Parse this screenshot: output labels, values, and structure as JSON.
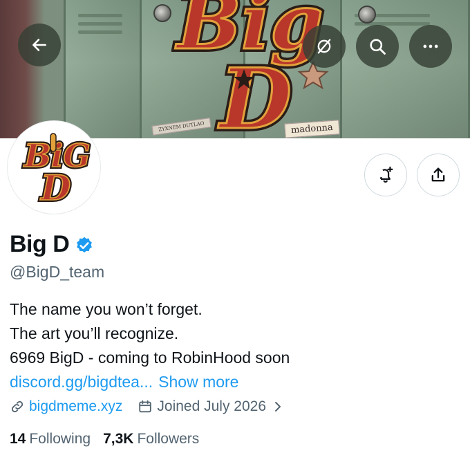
{
  "banner": {
    "sticker_text": "madonna",
    "sticker_small_text": "ZYXNEM DUTLAO"
  },
  "header_buttons": [
    {
      "icon": "back-arrow-icon"
    },
    {
      "icon": "translate-icon"
    },
    {
      "icon": "search-icon"
    },
    {
      "icon": "more-icon"
    }
  ],
  "actions": [
    {
      "icon": "notification-add-icon"
    },
    {
      "icon": "share-icon"
    }
  ],
  "profile": {
    "display_name": "Big D",
    "handle": "@BigD_team",
    "verified": true,
    "verified_color": "#1d9bf0",
    "bio_lines": [
      "The name you won’t forget.",
      "The art you’ll recognize.",
      "6969 BigD - coming to RobinHood soon"
    ],
    "bio_link": "discord.gg/bigdtea...",
    "show_more": "Show more",
    "website": "bigdmeme.xyz",
    "joined": "Joined July 2026",
    "following_count": "14",
    "following_label": "Following",
    "followers_count": "7,3K",
    "followers_label": "Followers"
  },
  "colors": {
    "accent": "#1d9bf0",
    "text_primary": "#0f1419",
    "text_secondary": "#536471",
    "logo_red": "#b8362a",
    "logo_gold": "#e2a13b",
    "logo_dark": "#2a1c17"
  }
}
